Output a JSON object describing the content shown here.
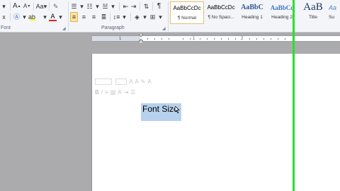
{
  "ribbon": {
    "groups": {
      "font_label": "Font",
      "paragraph_label": "Paragraph"
    },
    "font_row1": [
      "A",
      "A",
      "Aa"
    ],
    "styles": [
      {
        "preview": "AaBbCcDc",
        "name": "¶ Normal",
        "selected": true
      },
      {
        "preview": "AaBbCcDc",
        "name": "¶ No Spaci..."
      },
      {
        "preview": "AaBbC",
        "name": "Heading 1"
      },
      {
        "preview": "AaBbCc",
        "name": "Heading 2"
      },
      {
        "preview": "AaB",
        "name": "Title"
      },
      {
        "preview": "Aa",
        "name": "Su"
      }
    ]
  },
  "ruler": {
    "numbers": [
      "1",
      "1",
      "2"
    ]
  },
  "document": {
    "selected_text": "Font Size"
  },
  "colors": {
    "accent_green": "#27e22a",
    "selection": "#b6d1ee",
    "heading_blue": "#2f5597"
  }
}
